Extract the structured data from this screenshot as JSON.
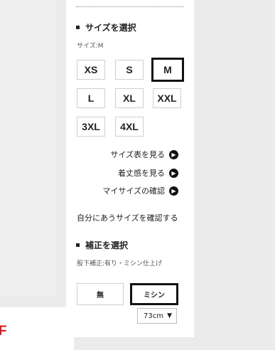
{
  "size_section": {
    "heading": "サイズを選択",
    "current": "サイズ:M",
    "sizes": [
      "XS",
      "S",
      "M",
      "L",
      "XL",
      "XXL",
      "3XL",
      "4XL"
    ],
    "selected": "M"
  },
  "links": {
    "size_chart": "サイズ表を見る",
    "fit": "着丈感を見る",
    "my_size": "マイサイズの確認",
    "check_fit": "自分にあうサイズを確認する",
    "arrow_icon": "chevron-right-icon"
  },
  "hem_section": {
    "heading": "補正を選択",
    "note": "股下補正:有り・ミシン仕上げ",
    "options": [
      "無",
      "ミシン"
    ],
    "selected": "ミシン",
    "length_value": "73cm"
  },
  "left": {
    "partial_letter": "F"
  },
  "colors": {
    "accent_red": "#e8171f",
    "selected_border": "#111111"
  }
}
